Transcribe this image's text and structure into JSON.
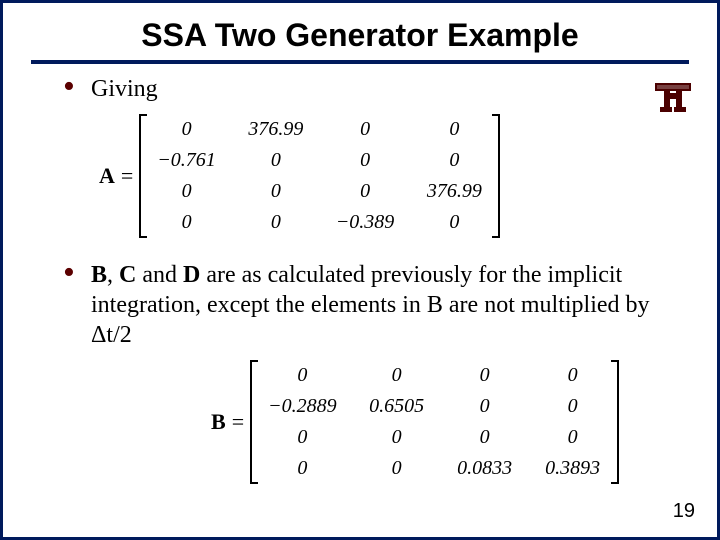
{
  "title": "SSA Two Generator Example",
  "logo_alt": "Texas A&M logo",
  "bullets": {
    "b1_text": "Giving",
    "b2_html": "<span class=\"bold\">B</span>, <span class=\"bold\">C</span> and <span class=\"bold\">D</span> are as calculated previously for the implicit integration, except the elements in B are not multiplied by Δt/2"
  },
  "matrix_A": {
    "label": "A",
    "rows": [
      [
        "0",
        "376.99",
        "0",
        "0"
      ],
      [
        "−0.761",
        "0",
        "0",
        "0"
      ],
      [
        "0",
        "0",
        "0",
        "376.99"
      ],
      [
        "0",
        "0",
        "−0.389",
        "0"
      ]
    ]
  },
  "matrix_B": {
    "label": "B",
    "rows": [
      [
        "0",
        "0",
        "0",
        "0"
      ],
      [
        "−0.2889",
        "0.6505",
        "0",
        "0"
      ],
      [
        "0",
        "0",
        "0",
        "0"
      ],
      [
        "0",
        "0",
        "0.0833",
        "0.3893"
      ]
    ]
  },
  "page_number": "19"
}
